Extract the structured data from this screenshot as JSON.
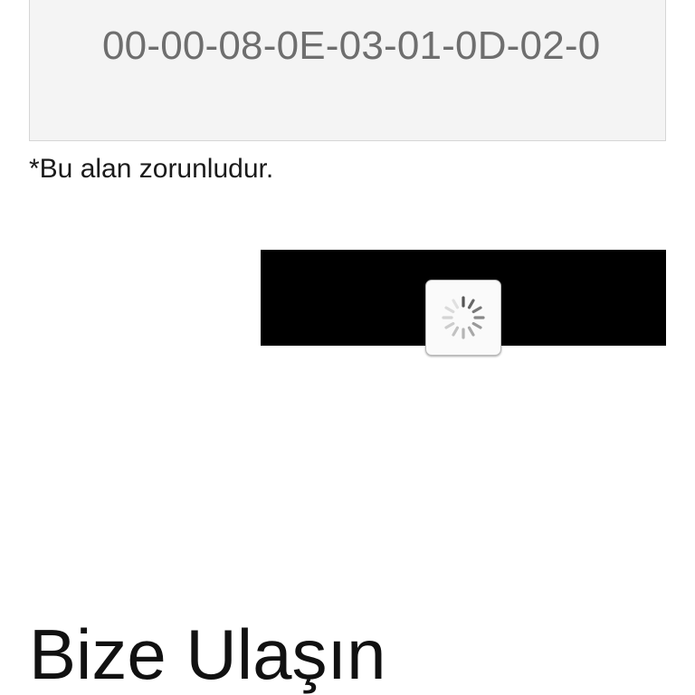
{
  "form": {
    "serial_field": {
      "value": "00-00-08-0E-03-01-0D-02-0"
    },
    "required_note": "*Bu alan zorunludur."
  },
  "submit": {
    "state": "loading",
    "spinner_icon": "loading-spinner-icon"
  },
  "contact": {
    "title": "Bize Ulaşın"
  },
  "colors": {
    "field_background": "#f4f4f4",
    "field_text": "#6e6e6e",
    "submit_background": "#000000"
  }
}
